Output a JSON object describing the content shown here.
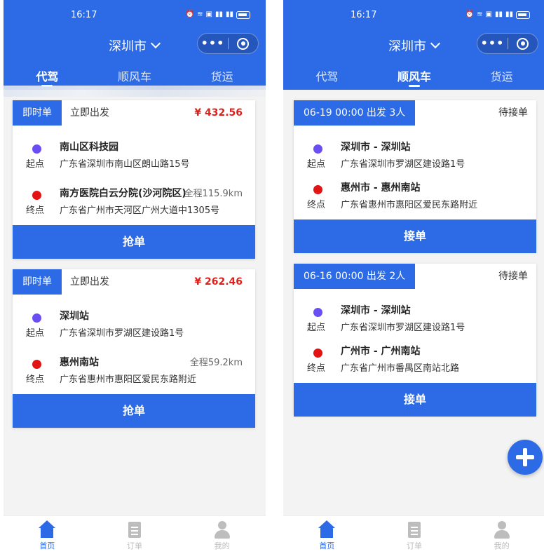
{
  "status_bar": {
    "time": "16:17",
    "icons": [
      "alarm-icon",
      "wifi-icon",
      "hd-icon",
      "signal-icon",
      "signal-icon",
      "battery-icon"
    ]
  },
  "header": {
    "city": "深圳市",
    "capsule": {
      "more": "•••"
    }
  },
  "tabs": [
    {
      "label": "代驾"
    },
    {
      "label": "顺风车"
    },
    {
      "label": "货运"
    }
  ],
  "left_screen": {
    "active_tab": 0,
    "orders": [
      {
        "tag": "即时单",
        "depart": "立即出发",
        "price": "¥ 432.56",
        "start": {
          "role": "起点",
          "place": "南山区科技园",
          "address": "广东省深圳市南山区朗山路15号"
        },
        "end": {
          "role": "终点",
          "place": "南方医院白云分院(沙河院区)",
          "address": "广东省广州市天河区广州大道中1305号",
          "distance": "全程115.9km"
        },
        "action": "抢单"
      },
      {
        "tag": "即时单",
        "depart": "立即出发",
        "price": "¥ 262.46",
        "start": {
          "role": "起点",
          "place": "深圳站",
          "address": "广东省深圳市罗湖区建设路1号"
        },
        "end": {
          "role": "终点",
          "place": "惠州南站",
          "address": "广东省惠州市惠阳区爱民东路附近",
          "distance": "全程59.2km"
        },
        "action": "抢单"
      }
    ]
  },
  "right_screen": {
    "active_tab": 1,
    "trips": [
      {
        "tag": "06-19 00:00 出发 3人",
        "status": "待接单",
        "start": {
          "role": "起点",
          "place": "深圳市 - 深圳站",
          "address": "广东省深圳市罗湖区建设路1号"
        },
        "end": {
          "role": "终点",
          "place": "惠州市 - 惠州南站",
          "address": "广东省惠州市惠阳区爱民东路附近"
        },
        "action": "接单"
      },
      {
        "tag": "06-16 00:00 出发 2人",
        "status": "待接单",
        "start": {
          "role": "起点",
          "place": "深圳市 - 深圳站",
          "address": "广东省深圳市罗湖区建设路1号"
        },
        "end": {
          "role": "终点",
          "place": "广州市 - 广州南站",
          "address": "广东省广州市番禺区南站北路"
        },
        "action": "接单"
      }
    ],
    "fab_icon": "plus-icon"
  },
  "bottom_nav": [
    {
      "label": "首页",
      "icon": "home-icon"
    },
    {
      "label": "订单",
      "icon": "order-icon"
    },
    {
      "label": "我的",
      "icon": "user-icon"
    }
  ],
  "colors": {
    "brand": "#2c6ae6",
    "price": "#e0201b",
    "start_dot": "#6a4ef2",
    "end_dot": "#e21313"
  }
}
